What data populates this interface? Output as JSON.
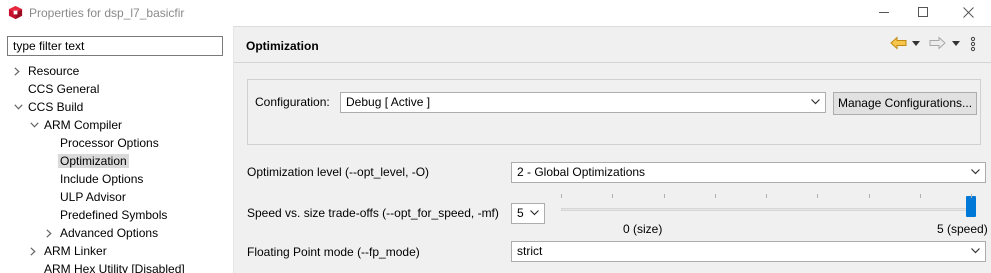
{
  "window": {
    "title": "Properties for dsp_l7_basicfir",
    "app_icon": "ccs-cube-icon",
    "controls": [
      "minimize-icon",
      "maximize-icon",
      "close-icon"
    ]
  },
  "left": {
    "filter_value": "type filter text",
    "tree": [
      {
        "label": "Resource",
        "twisty": "collapsed"
      },
      {
        "label": "CCS General",
        "twisty": "none"
      },
      {
        "label": "CCS Build",
        "twisty": "expanded"
      },
      {
        "label": "ARM Compiler",
        "twisty": "expanded"
      },
      {
        "label": "Processor Options",
        "twisty": "none"
      },
      {
        "label": "Optimization",
        "twisty": "none",
        "selected": true
      },
      {
        "label": "Include Options",
        "twisty": "none"
      },
      {
        "label": "ULP Advisor",
        "twisty": "none"
      },
      {
        "label": "Predefined Symbols",
        "twisty": "none"
      },
      {
        "label": "Advanced Options",
        "twisty": "collapsed"
      },
      {
        "label": "ARM Linker",
        "twisty": "collapsed"
      },
      {
        "label": "ARM Hex Utility  [Disabled]",
        "twisty": "none"
      }
    ]
  },
  "right": {
    "title": "Optimization",
    "nav_icons": [
      "back-arrow-icon",
      "back-dropdown-icon",
      "forward-arrow-icon",
      "forward-dropdown-icon",
      "view-menu-icon"
    ],
    "configuration": {
      "label": "Configuration:",
      "value": "Debug  [ Active ]",
      "manage_button": "Manage Configurations..."
    },
    "opt_level": {
      "label": "Optimization level (--opt_level, -O)",
      "value": "2 - Global Optimizations"
    },
    "speed_size": {
      "label": "Speed vs. size trade-offs (--opt_for_speed, -mf)",
      "value": "5",
      "slider_value": 5,
      "slider_min": 0,
      "slider_max": 5,
      "min_label": "0 (size)",
      "max_label": "5 (speed)"
    },
    "fp_mode": {
      "label": "Floating Point mode (--fp_mode)",
      "value": "strict"
    }
  },
  "colors": {
    "accent": "#0078d7",
    "panel_bg": "#f0f0f0",
    "selection": "#dadada",
    "back_arrow": "#e8a317"
  }
}
